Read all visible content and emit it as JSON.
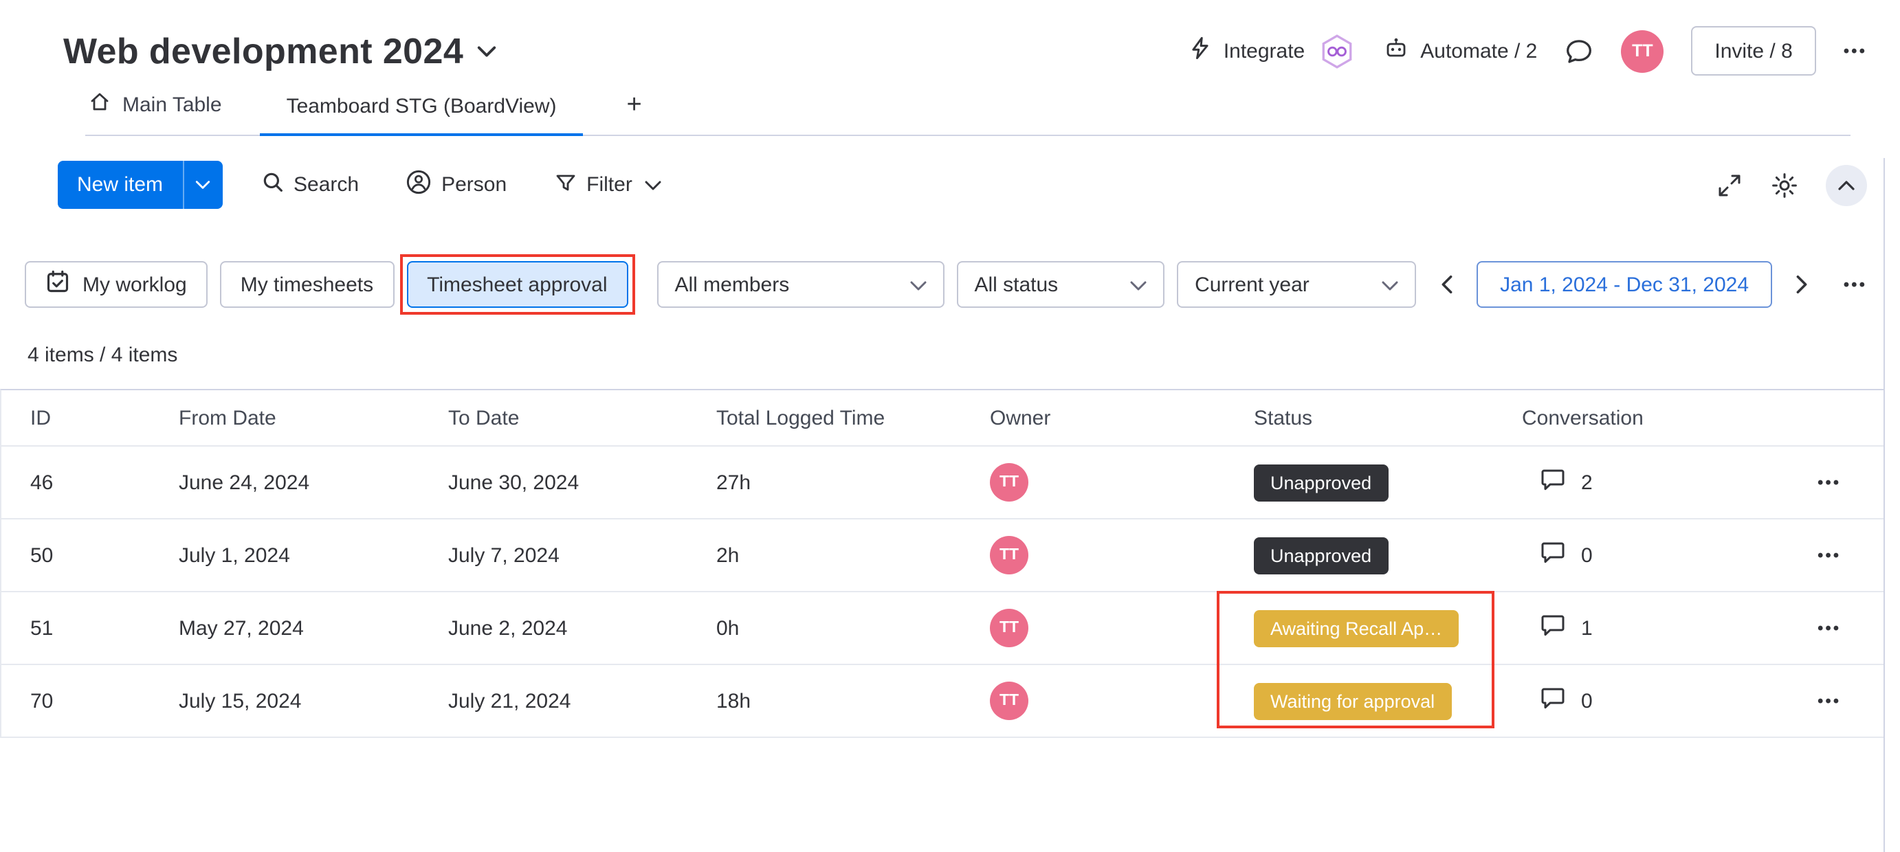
{
  "header": {
    "board_title": "Web development 2024",
    "integrate_label": "Integrate",
    "automate_label": "Automate / 2",
    "invite_label": "Invite / 8",
    "avatar_initials": "TT"
  },
  "tabs": {
    "main_table": "Main Table",
    "board_view": "Teamboard STG (BoardView)"
  },
  "toolbar": {
    "new_item": "New item",
    "search": "Search",
    "person": "Person",
    "filter": "Filter"
  },
  "filterbar": {
    "my_worklog": "My worklog",
    "my_timesheets": "My timesheets",
    "timesheet_approval": "Timesheet approval",
    "all_members": "All members",
    "all_status": "All status",
    "current_year": "Current year",
    "date_range": "Jan 1, 2024 - Dec 31, 2024"
  },
  "summary": {
    "items_count": "4 items / 4 items"
  },
  "table": {
    "columns": {
      "id": "ID",
      "from": "From Date",
      "to": "To Date",
      "time": "Total Logged Time",
      "owner": "Owner",
      "status": "Status",
      "conversation": "Conversation"
    },
    "rows": [
      {
        "id": "46",
        "from": "June 24, 2024",
        "to": "June 30, 2024",
        "time": "27h",
        "owner": "TT",
        "status": "Unapproved",
        "conversations": "2"
      },
      {
        "id": "50",
        "from": "July 1, 2024",
        "to": "July 7, 2024",
        "time": "2h",
        "owner": "TT",
        "status": "Unapproved",
        "conversations": "0"
      },
      {
        "id": "51",
        "from": "May 27, 2024",
        "to": "June 2, 2024",
        "time": "0h",
        "owner": "TT",
        "status": "Awaiting Recall Ap…",
        "conversations": "1"
      },
      {
        "id": "70",
        "from": "July 15, 2024",
        "to": "July 21, 2024",
        "time": "18h",
        "owner": "TT",
        "status": "Waiting for approval",
        "conversations": "0"
      }
    ]
  },
  "icons": {
    "dots": "•••",
    "plus": "+"
  },
  "colors": {
    "accent_blue": "#0073ea",
    "badge_dark": "#323338",
    "badge_yellow": "#e0b23e",
    "avatar_pink": "#ec6d8b",
    "annotation_red": "#ef392c"
  }
}
